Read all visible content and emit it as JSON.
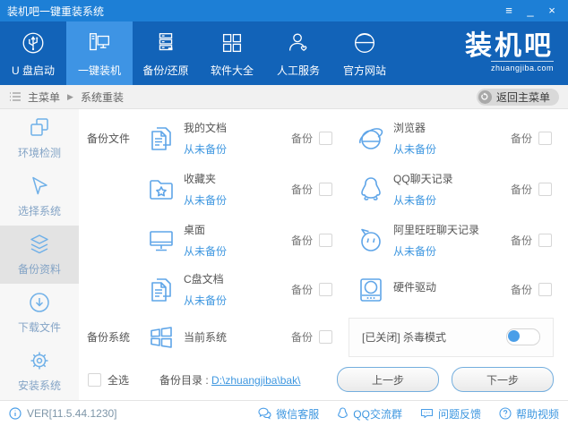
{
  "window": {
    "title": "装机吧一键重装系统",
    "controls": {
      "menu": "≡",
      "minimize": "_",
      "close": "×"
    }
  },
  "nav": {
    "items": [
      {
        "label": "U 盘启动"
      },
      {
        "label": "一键装机"
      },
      {
        "label": "备份/还原"
      },
      {
        "label": "软件大全"
      },
      {
        "label": "人工服务"
      },
      {
        "label": "官方网站"
      }
    ],
    "logo": {
      "brand": "装机吧",
      "domain": "zhuangjiba.com"
    }
  },
  "breadcrumb": {
    "root": "主菜单",
    "arrow": "▶",
    "current": "系统重装",
    "back_button": "返回主菜单"
  },
  "sidebar": {
    "items": [
      {
        "label": "环境检测"
      },
      {
        "label": "选择系统"
      },
      {
        "label": "备份资料"
      },
      {
        "label": "下载文件"
      },
      {
        "label": "安装系统"
      }
    ]
  },
  "main": {
    "section_backup_files": "备份文件",
    "section_backup_system": "备份系统",
    "backup_label": "备份",
    "rows": [
      {
        "left": {
          "title": "我的文档",
          "status": "从未备份"
        },
        "right": {
          "title": "浏览器",
          "status": "从未备份"
        }
      },
      {
        "left": {
          "title": "收藏夹",
          "status": "从未备份"
        },
        "right": {
          "title": "QQ聊天记录",
          "status": "从未备份"
        }
      },
      {
        "left": {
          "title": "桌面",
          "status": "从未备份"
        },
        "right": {
          "title": "阿里旺旺聊天记录",
          "status": "从未备份"
        }
      },
      {
        "left": {
          "title": "C盘文档",
          "status": "从未备份"
        },
        "right": {
          "title": "硬件驱动",
          "status": ""
        }
      },
      {
        "left": {
          "title": "当前系统",
          "status": ""
        }
      }
    ],
    "antivirus": {
      "label": "[已关闭] 杀毒模式",
      "state": "off"
    },
    "select_all_label": "全选",
    "backup_dir": {
      "label": "备份目录 :",
      "path": "D:\\zhuangjiba\\bak\\"
    },
    "prev_label": "上一步",
    "next_label": "下一步",
    "accent_color": "#3e97e0"
  },
  "statusbar": {
    "version": "VER[11.5.44.1230]",
    "links": [
      {
        "label": "微信客服"
      },
      {
        "label": "QQ交流群"
      },
      {
        "label": "问题反馈"
      },
      {
        "label": "帮助视频"
      }
    ]
  }
}
